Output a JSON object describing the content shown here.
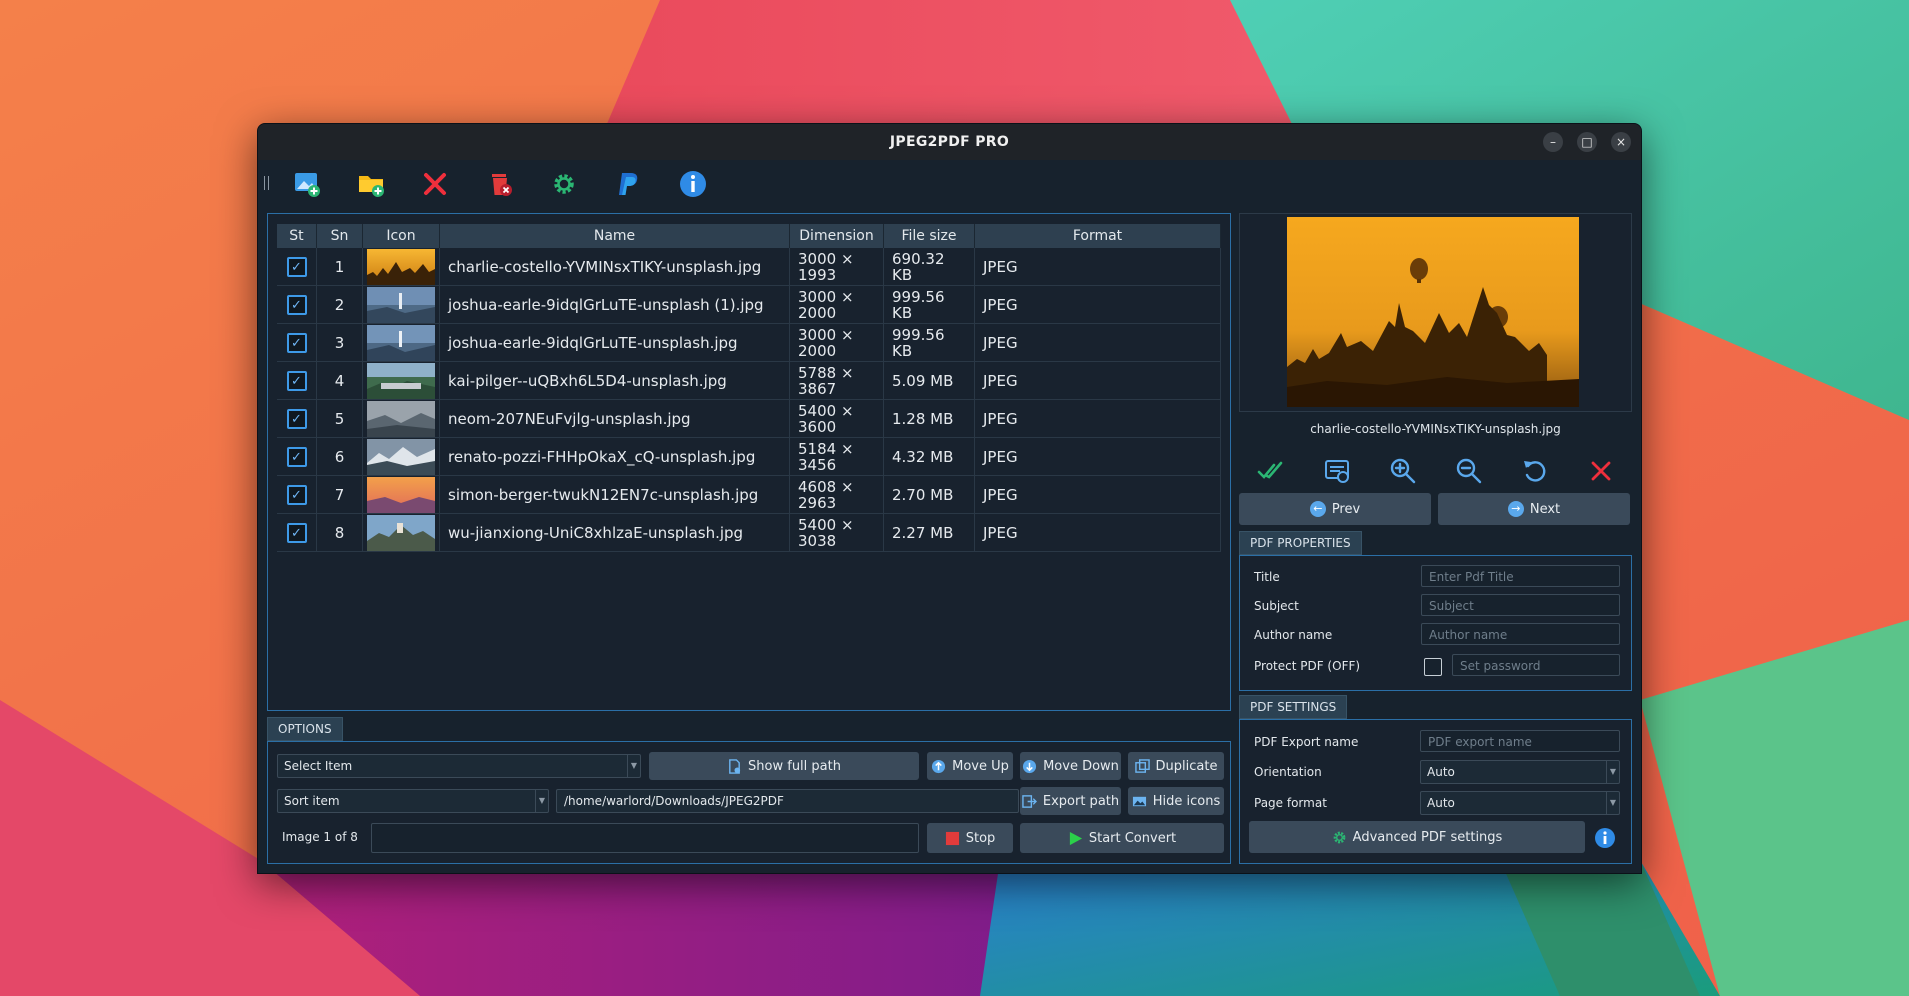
{
  "window": {
    "title": "JPEG2PDF PRO",
    "minimize": "–",
    "maximize": "□",
    "close": "×"
  },
  "toolbar": {
    "icons": [
      "add-image-icon",
      "add-folder-icon",
      "remove-icon",
      "delete-all-icon",
      "settings-icon",
      "paypal-icon",
      "info-icon"
    ]
  },
  "table": {
    "headers": {
      "st": "St",
      "sn": "Sn",
      "icon": "Icon",
      "name": "Name",
      "dimension": "Dimension",
      "filesize": "File size",
      "format": "Format"
    },
    "rows": [
      {
        "sn": "1",
        "name": "charlie-costello-YVMINsxTIKY-unsplash.jpg",
        "dim1": "3000 ×",
        "dim2": "1993",
        "size1": "690.32",
        "size2": "KB",
        "format": "JPEG"
      },
      {
        "sn": "2",
        "name": "joshua-earle-9idqlGrLuTE-unsplash (1).jpg",
        "dim1": "3000 ×",
        "dim2": "2000",
        "size1": "999.56",
        "size2": "KB",
        "format": "JPEG"
      },
      {
        "sn": "3",
        "name": "joshua-earle-9idqlGrLuTE-unsplash.jpg",
        "dim1": "3000 ×",
        "dim2": "2000",
        "size1": "999.56",
        "size2": "KB",
        "format": "JPEG"
      },
      {
        "sn": "4",
        "name": "kai-pilger--uQBxh6L5D4-unsplash.jpg",
        "dim1": "5788 ×",
        "dim2": "3867",
        "size1": "5.09 MB",
        "size2": "",
        "format": "JPEG"
      },
      {
        "sn": "5",
        "name": "neom-207NEuFvjlg-unsplash.jpg",
        "dim1": "5400 ×",
        "dim2": "3600",
        "size1": "1.28 MB",
        "size2": "",
        "format": "JPEG"
      },
      {
        "sn": "6",
        "name": "renato-pozzi-FHHpOkaX_cQ-unsplash.jpg",
        "dim1": "5184 ×",
        "dim2": "3456",
        "size1": "4.32 MB",
        "size2": "",
        "format": "JPEG"
      },
      {
        "sn": "7",
        "name": "simon-berger-twukN12EN7c-unsplash.jpg",
        "dim1": "4608 ×",
        "dim2": "2963",
        "size1": "2.70 MB",
        "size2": "",
        "format": "JPEG"
      },
      {
        "sn": "8",
        "name": "wu-jianxiong-UniC8xhlzaE-unsplash.jpg",
        "dim1": "5400 ×",
        "dim2": "3038",
        "size1": "2.27 MB",
        "size2": "",
        "format": "JPEG"
      }
    ]
  },
  "preview": {
    "filename": "charlie-costello-YVMINsxTIKY-unsplash.jpg",
    "prev": "Prev",
    "next": "Next",
    "icons": [
      "check-all-icon",
      "fit-view-icon",
      "zoom-in-icon",
      "zoom-out-icon",
      "rotate-icon",
      "close-preview-icon"
    ]
  },
  "options": {
    "tab": "OPTIONS",
    "select_item": "Select Item",
    "show_full_path": "Show full path",
    "move_up": "Move Up",
    "move_down": "Move Down",
    "duplicate": "Duplicate",
    "sort_item": "Sort item",
    "path": "/home/warlord/Downloads/JPEG2PDF",
    "export_path": "Export path",
    "hide_icons": "Hide icons",
    "status": "Image 1 of 8",
    "stop": "Stop",
    "start_convert": "Start Convert"
  },
  "pdf_properties": {
    "tab": "PDF PROPERTIES",
    "title_label": "Title",
    "title_placeholder": "Enter Pdf Title",
    "subject_label": "Subject",
    "subject_placeholder": "Subject",
    "author_label": "Author name",
    "author_placeholder": "Author name",
    "protect_label": "Protect PDF (OFF)",
    "password_placeholder": "Set password"
  },
  "pdf_settings": {
    "tab": "PDF SETTINGS",
    "export_label": "PDF Export name",
    "export_placeholder": "PDF export name",
    "orientation_label": "Orientation",
    "orientation_value": "Auto",
    "page_format_label": "Page format",
    "page_format_value": "Auto",
    "advanced": "Advanced PDF settings"
  },
  "colors": {
    "accent": "#2b6fa6",
    "window_bg": "#17222d",
    "button_bg": "#3a4a5a",
    "check": "#3e9ae8"
  }
}
